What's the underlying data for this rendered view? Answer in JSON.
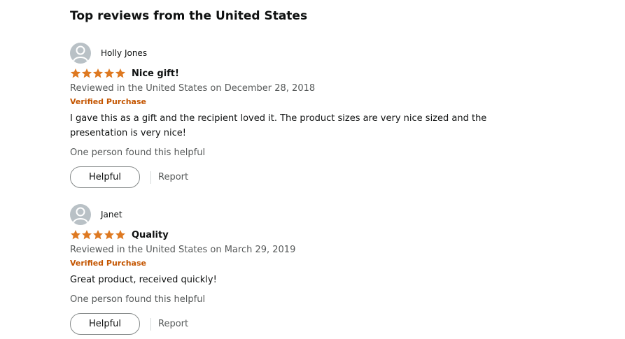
{
  "section": {
    "title": "Top reviews from the United States"
  },
  "colors": {
    "star": "#de7921",
    "verified": "#c45500",
    "muted": "#565959",
    "avatar_bg": "#b9c1c6"
  },
  "reviews": [
    {
      "author": "Holly Jones",
      "rating": 5,
      "title": "Nice gift!",
      "date": "Reviewed in the United States on December 28, 2018",
      "badge": "Verified Purchase",
      "body": "I gave this as a gift and the recipient loved it. The product sizes are very nice sized and the presentation is very nice!",
      "helpful_count": "One person found this helpful",
      "helpful_label": "Helpful",
      "report_label": "Report"
    },
    {
      "author": "Janet",
      "rating": 5,
      "title": "Quality",
      "date": "Reviewed in the United States on March 29, 2019",
      "badge": "Verified Purchase",
      "body": "Great product, received quickly!",
      "helpful_count": "One person found this helpful",
      "helpful_label": "Helpful",
      "report_label": "Report"
    }
  ]
}
